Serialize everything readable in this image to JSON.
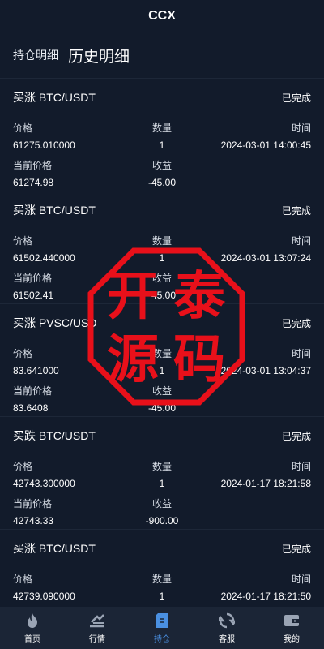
{
  "header": {
    "title": "CCX"
  },
  "tabs": [
    {
      "label": "持仓明细"
    },
    {
      "label": "历史明细"
    }
  ],
  "columns": {
    "price": "价格",
    "qty": "数量",
    "time": "时间",
    "current_price": "当前价格",
    "profit": "收益"
  },
  "orders": [
    {
      "pair": "买涨 BTC/USDT",
      "status": "已完成",
      "price": "61275.010000",
      "qty": "1",
      "time": "2024-03-01 14:00:45",
      "current_price": "61274.98",
      "profit": "-45.00"
    },
    {
      "pair": "买涨 BTC/USDT",
      "status": "已完成",
      "price": "61502.440000",
      "qty": "1",
      "time": "2024-03-01 13:07:24",
      "current_price": "61502.41",
      "profit": "-45.00"
    },
    {
      "pair": "买涨 PVSC/USD",
      "status": "已完成",
      "price": "83.641000",
      "qty": "1",
      "time": "2024-03-01 13:04:37",
      "current_price": "83.6408",
      "profit": "-45.00"
    },
    {
      "pair": "买跌 BTC/USDT",
      "status": "已完成",
      "price": "42743.300000",
      "qty": "1",
      "time": "2024-01-17 18:21:58",
      "current_price": "42743.33",
      "profit": "-900.00"
    },
    {
      "pair": "买涨 BTC/USDT",
      "status": "已完成",
      "price": "42739.090000",
      "qty": "1",
      "time": "2024-01-17 18:21:50",
      "current_price": "",
      "profit": ""
    }
  ],
  "watermark": {
    "text": "开泰源码",
    "color": "#e8101a"
  },
  "nav": [
    {
      "label": "首页",
      "icon": "flame-icon"
    },
    {
      "label": "行情",
      "icon": "market-icon"
    },
    {
      "label": "持仓",
      "icon": "position-icon",
      "active": true
    },
    {
      "label": "客服",
      "icon": "service-icon"
    },
    {
      "label": "我的",
      "icon": "wallet-icon"
    }
  ],
  "colors": {
    "background": "#121b2b",
    "nav_background": "#1b2536",
    "active": "#4a90e2"
  }
}
